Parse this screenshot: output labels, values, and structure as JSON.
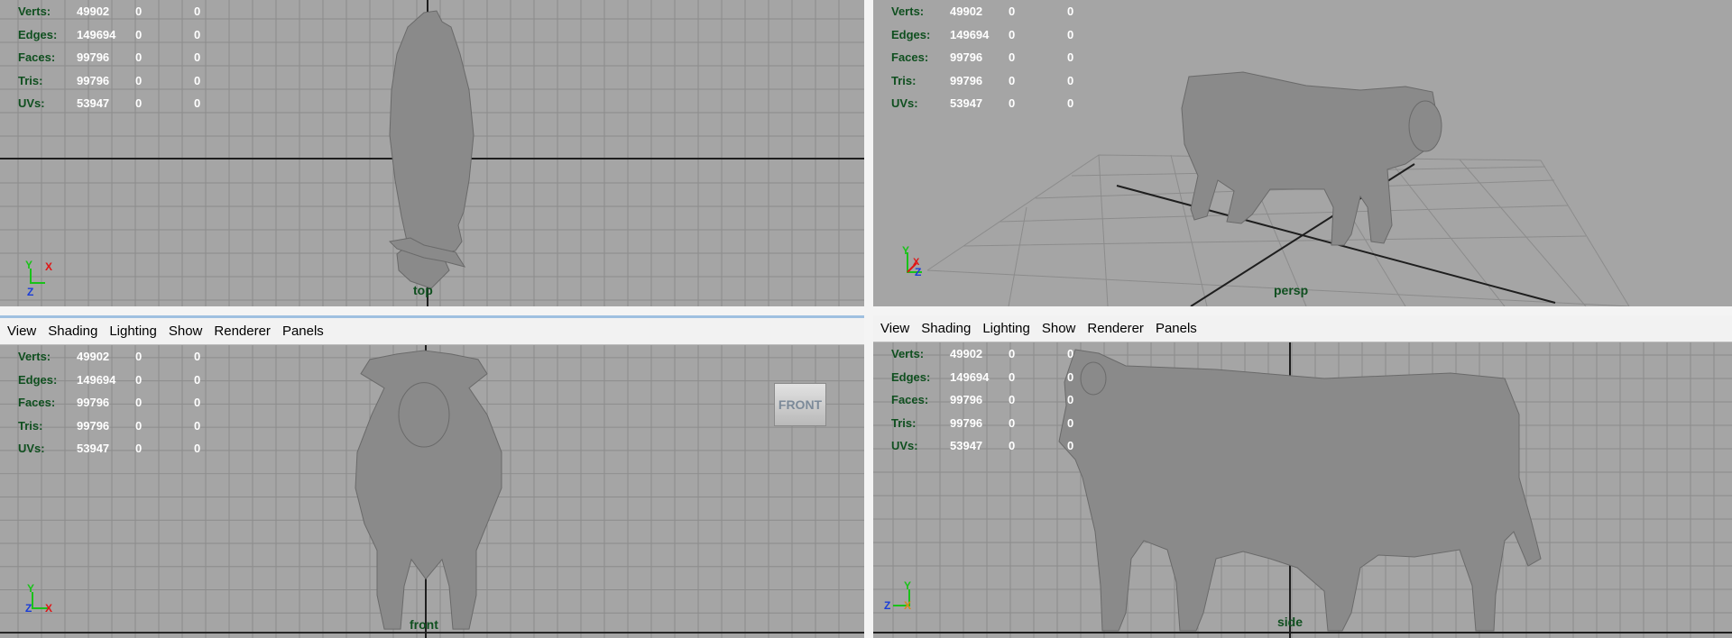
{
  "menu": [
    "View",
    "Shading",
    "Lighting",
    "Show",
    "Renderer",
    "Panels"
  ],
  "hud": {
    "rows": [
      {
        "label": "Verts:",
        "value": "49902",
        "a": "0",
        "b": "0"
      },
      {
        "label": "Edges:",
        "value": "149694",
        "a": "0",
        "b": "0"
      },
      {
        "label": "Faces:",
        "value": "99796",
        "a": "0",
        "b": "0"
      },
      {
        "label": "Tris:",
        "value": "99796",
        "a": "0",
        "b": "0"
      },
      {
        "label": "UVs:",
        "value": "53947",
        "a": "0",
        "b": "0"
      }
    ]
  },
  "viewports": {
    "top": {
      "camera": "top",
      "axes": {
        "first": "Y",
        "second": "X",
        "third": "Z"
      }
    },
    "persp": {
      "camera": "persp",
      "axes": {
        "first": "Y",
        "second": "X",
        "third": "Z"
      }
    },
    "front": {
      "camera": "front",
      "viewcube": "FRONT",
      "axes": {
        "first": "Y",
        "second": "Z",
        "third": "X"
      }
    },
    "side": {
      "camera": "side",
      "axes": {
        "first": "Y",
        "second": "Z",
        "third": "X"
      }
    }
  },
  "colors": {
    "viewport_bg": "#a5a5a5",
    "grid": "#8c8c8c",
    "hud_label": "#0f4f1f",
    "axis_y": "#19c219",
    "axis_x": "#e01515",
    "axis_z": "#1a3dd8",
    "axis_x_side": "#d88a1a",
    "model": "#8a8a8a"
  }
}
